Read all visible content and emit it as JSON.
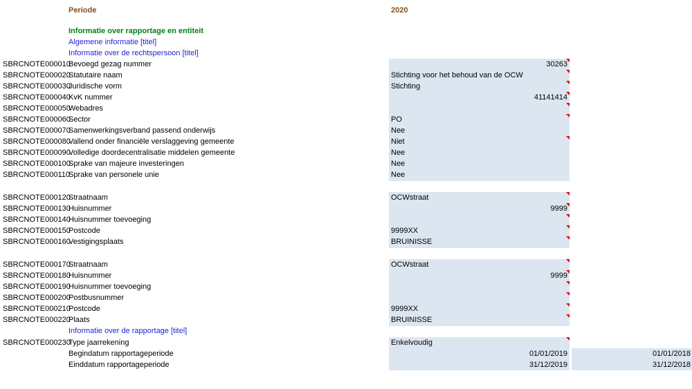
{
  "header": {
    "periode_label": "Periode",
    "year": "2020"
  },
  "sections": {
    "info_title": "Informatie over rapportage en entiteit",
    "algemeen": "Algemene informatie [titel]",
    "rechtspersoon": "Informatie over de rechtspersoon [titel]",
    "rapportage": "Informatie over de rapportage [titel]"
  },
  "rows": [
    {
      "code": "SBRCNOTE000010",
      "label": "Bevoegd gezag nummer",
      "value": "30263"
    },
    {
      "code": "SBRCNOTE000020",
      "label": "Statutaire naam",
      "value": "Stichting voor het behoud van de OCW"
    },
    {
      "code": "SBRCNOTE000030",
      "label": "Juridische vorm",
      "value": "Stichting"
    },
    {
      "code": "SBRCNOTE000040",
      "label": "KvK nummer",
      "value": "41141414"
    },
    {
      "code": "SBRCNOTE000050",
      "label": "Webadres",
      "value": ""
    },
    {
      "code": "SBRCNOTE000060",
      "label": "Sector",
      "value": "PO"
    },
    {
      "code": "SBRCNOTE000070",
      "label": "Samenwerkingsverband passend onderwijs",
      "value": "Nee"
    },
    {
      "code": "SBRCNOTE000080",
      "label": "Vallend onder financiële verslaggeving gemeente",
      "value": "Niet"
    },
    {
      "code": "SBRCNOTE000090",
      "label": "Volledige doordecentralisatie middelen gemeente",
      "value": "Nee"
    },
    {
      "code": "SBRCNOTE000100",
      "label": "Sprake van majeure investeringen",
      "value": "Nee"
    },
    {
      "code": "SBRCNOTE000110",
      "label": "Sprake van personele unie",
      "value": "Nee"
    },
    {
      "code": "SBRCNOTE000120",
      "label": "Straatnaam",
      "value": "OCWstraat"
    },
    {
      "code": "SBRCNOTE000130",
      "label": "Huisnummer",
      "value": "9999"
    },
    {
      "code": "SBRCNOTE000140",
      "label": "Huisnummer toevoeging",
      "value": ""
    },
    {
      "code": "SBRCNOTE000150",
      "label": "Postcode",
      "value": "9999XX"
    },
    {
      "code": "SBRCNOTE000160",
      "label": "Vestigingsplaats",
      "value": "BRUINISSE"
    },
    {
      "code": "SBRCNOTE000170",
      "label": "Straatnaam",
      "value": "OCWstraat"
    },
    {
      "code": "SBRCNOTE000180",
      "label": "Huisnummer",
      "value": "9999"
    },
    {
      "code": "SBRCNOTE000190",
      "label": "Huisnummer toevoeging",
      "value": ""
    },
    {
      "code": "SBRCNOTE000200",
      "label": "Postbusnummer",
      "value": ""
    },
    {
      "code": "SBRCNOTE000210",
      "label": "Postcode",
      "value": "9999XX"
    },
    {
      "code": "SBRCNOTE000220",
      "label": "Plaats",
      "value": "BRUINISSE"
    },
    {
      "code": "SBRCNOTE000230",
      "label": "Type jaarrekening",
      "value": "Enkelvoudig"
    }
  ],
  "period": {
    "begin_label": "Begindatum rapportageperiode",
    "end_label": "Einddatum rapportageperiode",
    "begin_2020": "01/01/2019",
    "end_2020": "31/12/2019",
    "begin_prev": "01/01/2018",
    "end_prev": "31/12/2018"
  },
  "colors": {
    "header": "#7f4f1f",
    "green_title": "#00801a",
    "blue_title": "#1f1fd6",
    "cell_fill": "#dce6f0",
    "comment_marker": "#e00000"
  }
}
